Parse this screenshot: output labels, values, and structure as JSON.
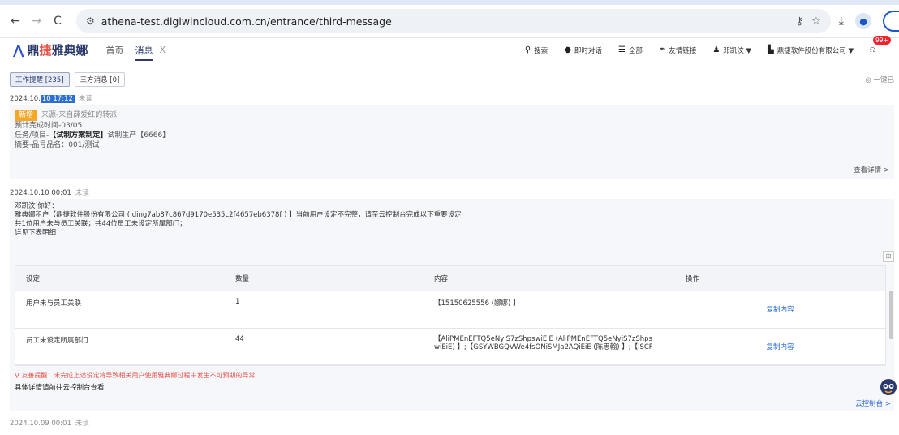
{
  "browser": {
    "url": "athena-test.digiwincloud.com.cn/entrance/third-message"
  },
  "app": {
    "logo_text_1": "鼎",
    "logo_text_accent": "捷",
    "logo_text_2": "雅典娜",
    "nav": {
      "home": "首页",
      "messages": "消息",
      "close": "X"
    },
    "header_right": {
      "search": "搜索",
      "chat": "即时对话",
      "all": "全部",
      "links": "友情链接",
      "user": "邓凯汶 ▼",
      "company": "鼎捷软件股份有限公司 ▼",
      "badge": "99+"
    }
  },
  "tabs": {
    "work": "工作提醒 [235]",
    "third": "三方消息 [0]",
    "mark_read": "◎ 一键已"
  },
  "messages": [
    {
      "date_prefix": "2024.10.",
      "date_hl": "10 17:12",
      "unread": "未读",
      "tag": "新增",
      "source": "来源-来自薛爱红的转派",
      "due": "预计完成时间-03/05",
      "task_prefix": "任务/项目-",
      "task_bold": "【试制方案制定】",
      "task_rest": "试制生产【6666】",
      "summary": "摘要-品号品名：001/测试",
      "view_detail": "查看详情 >"
    },
    {
      "date": "2024.10.10 00:01",
      "unread": "未读",
      "greeting": "邓凯汶 你好：",
      "body1": "雅典娜租户【鼎捷软件股份有限公司 ( ding7ab87c867d9170e535c2f4657eb6378f ) 】当前用户设定不完整，请至云控制台完成以下重要设定",
      "body2": "共1位用户未与员工关联；共44位员工未设定所属部门；",
      "body3": "详见下表明细",
      "table": {
        "headers": [
          "设定",
          "数量",
          "内容",
          "操作"
        ],
        "rows": [
          {
            "setting": "用户未与员工关联",
            "count": "1",
            "content": "【15150625556 (娜娜) 】",
            "op": "复制内容"
          },
          {
            "setting": "员工未设定所属部门",
            "count": "44",
            "content": "【AliPMEnEFTQ5eNyiS7zShpswiEiE (AliPMEnEFTQ5eNyiS7zShps wiEiE) 】;【GSYWBGQVWe4fsONiSMJa2AQiEiE (陈思翰) 】;【iSCF",
            "op": "复制内容"
          }
        ]
      },
      "warn": "友善提醒：未完成上述设定将导致相关用户使用雅典娜过程中发生不可预期的异常",
      "cloud_tip": "具体详情请前往云控制台查看",
      "cloud_link": "云控制台 >"
    },
    {
      "date": "2024.10.09 00:01",
      "unread": "未读"
    }
  ],
  "colors": {
    "accent": "#2b6fd6",
    "tag": "#f5a623",
    "warn": "#e8534a"
  }
}
